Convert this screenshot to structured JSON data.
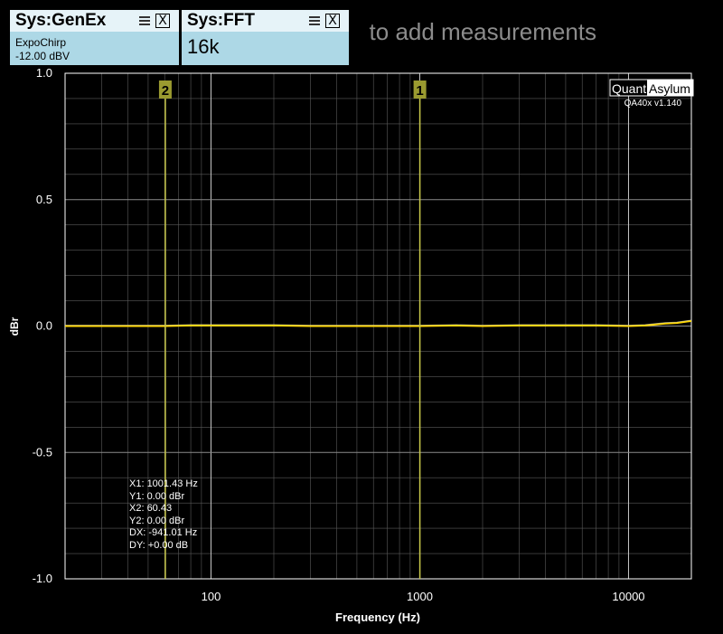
{
  "hint_text": "to add measurements",
  "panels": {
    "genex": {
      "title": "Sys:GenEx",
      "close_label": "X",
      "line1": "ExpoChirp",
      "line2": "-12.00 dBV"
    },
    "fft": {
      "title": "Sys:FFT",
      "close_label": "X",
      "value": "16k"
    }
  },
  "logo": {
    "part1": "Quant",
    "part2": "Asylum",
    "version": "QA40x v1.140"
  },
  "cursor_readout": {
    "x1": "X1: 1001.43 Hz",
    "y1": "Y1: 0.00 dBr",
    "x2": "X2: 60.43",
    "y2": "Y2: 0.00 dBr",
    "dx": "DX: -941.01 Hz",
    "dy": "DY: +0.00  dB"
  },
  "colors": {
    "background": "#000000",
    "grid": "#5a5a5a",
    "trace": "#ffd700",
    "trace_secondary": "#e8e8c8",
    "marker": "#c8c84a",
    "marker_label_bg": "#9a9a30",
    "panel": "#add8e6",
    "panel_header": "#e6f3f8"
  },
  "chart_data": {
    "type": "line",
    "title": "",
    "xlabel": "Frequency (Hz)",
    "ylabel": "dBr",
    "xscale": "log",
    "xlim": [
      20,
      20000
    ],
    "ylim": [
      -1.0,
      1.0
    ],
    "yticks": [
      "1.0",
      "0.5",
      "0.0",
      "-0.5",
      "-1.0"
    ],
    "ytick_values": [
      1.0,
      0.5,
      0.0,
      -0.5,
      -1.0
    ],
    "xticks": [
      "100",
      "1000",
      "10000"
    ],
    "xtick_values": [
      100,
      1000,
      10000
    ],
    "grid": true,
    "series": [
      {
        "x": [
          20,
          30,
          50,
          60,
          80,
          100,
          150,
          200,
          300,
          500,
          700,
          1000,
          1500,
          2000,
          3000,
          5000,
          7000,
          10000,
          12000,
          15000,
          17000,
          20000
        ],
        "y": [
          0.0,
          0.0,
          0.0,
          0.0,
          0.002,
          0.002,
          0.002,
          0.002,
          0.0,
          0.0,
          0.0,
          0.0,
          0.002,
          0.0,
          0.002,
          0.002,
          0.002,
          0.0,
          0.002,
          0.01,
          0.012,
          0.02
        ]
      }
    ],
    "markers": [
      {
        "label": "1",
        "x": 1001.43
      },
      {
        "label": "2",
        "x": 60.43
      }
    ]
  }
}
